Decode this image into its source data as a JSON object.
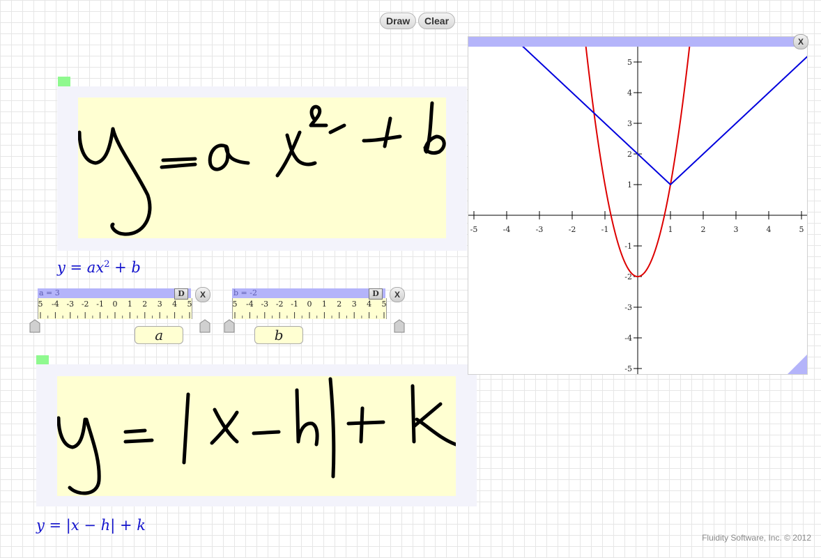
{
  "toolbar": {
    "draw_label": "Draw",
    "clear_label": "Clear"
  },
  "formula1": {
    "left": "y = ax",
    "exponent": "2",
    "right": " + b"
  },
  "formula2": {
    "text": "y = |x − h| + k"
  },
  "slider_a": {
    "value_text": "a = 3",
    "d_label": "D",
    "close_label": "X",
    "name": "a",
    "value": 3,
    "range": [
      -5,
      5
    ],
    "ticks": [
      "5",
      "-4",
      "-3",
      "-2",
      "-1",
      "0",
      "1",
      "2",
      "3",
      "4",
      "5"
    ]
  },
  "slider_b": {
    "value_text": "b = -2",
    "d_label": "D",
    "close_label": "X",
    "name": "b",
    "value": -2,
    "range": [
      -5,
      5
    ],
    "ticks": [
      "5",
      "-4",
      "-3",
      "-2",
      "-1",
      "0",
      "1",
      "2",
      "3",
      "4",
      "5"
    ]
  },
  "graph": {
    "close_label": "X",
    "colors": {
      "parabola": "#dd0000",
      "absolute": "#0000dd"
    }
  },
  "chart_data": {
    "type": "line",
    "xlim": [
      -5,
      5
    ],
    "ylim": [
      -5,
      5
    ],
    "x_ticks": [
      "-5",
      "-4",
      "-3",
      "-2",
      "-1",
      "1",
      "2",
      "3",
      "4",
      "5"
    ],
    "y_ticks": [
      "5",
      "4",
      "3",
      "2",
      "1",
      "-1",
      "-2",
      "-3",
      "-4",
      "-5"
    ],
    "series": [
      {
        "formula": "3x^2 - 2",
        "color": "#dd0000"
      },
      {
        "formula": "|x - 1| + 1",
        "color": "#0000dd"
      }
    ]
  },
  "footer": {
    "text": "Fluidity Software, Inc. © 2012"
  }
}
